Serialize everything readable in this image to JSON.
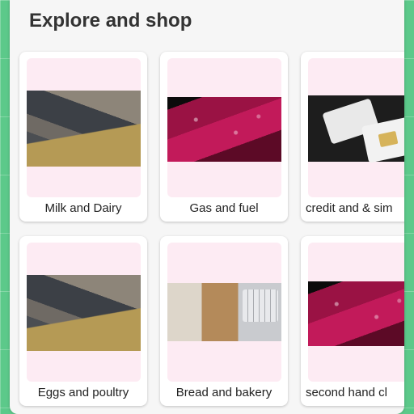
{
  "header": {
    "title": "Explore and shop"
  },
  "categories": [
    {
      "label": "Milk and Dairy",
      "image": "mountain-photo"
    },
    {
      "label": "Gas and fuel",
      "image": "red-leaf-photo"
    },
    {
      "label": "credit and & sim",
      "image": "sim-card-photo"
    },
    {
      "label": "Eggs and poultry",
      "image": "mountain-photo"
    },
    {
      "label": "Bread and bakery",
      "image": "desk-photo"
    },
    {
      "label": "second hand cl",
      "image": "red-leaf-photo"
    }
  ],
  "colors": {
    "background": "#5cc98a",
    "panel": "#f6f6f6",
    "tile": "#fdebf3"
  }
}
